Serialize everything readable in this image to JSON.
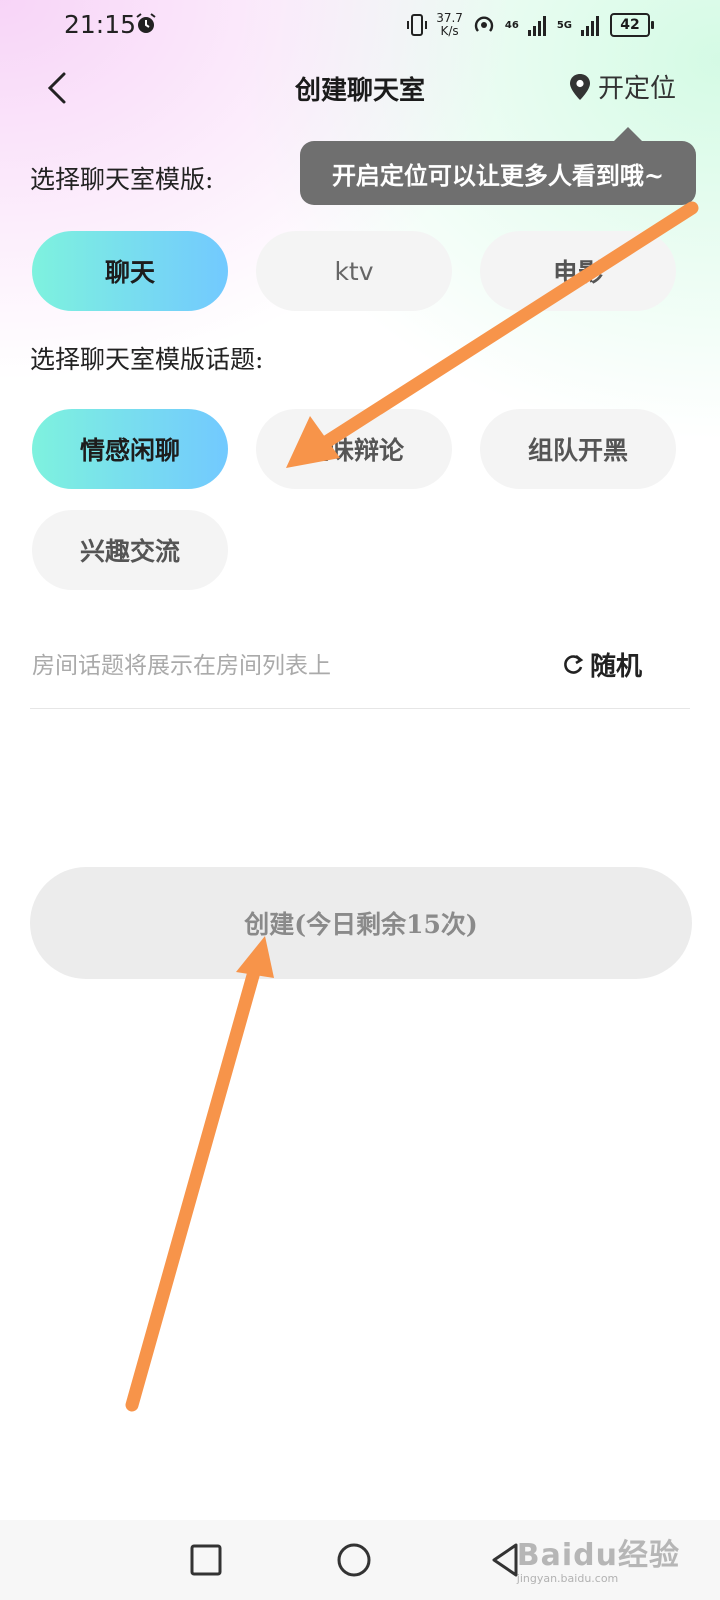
{
  "status_bar": {
    "time": "21:15",
    "net_speed_value": "37.7",
    "net_speed_unit": "K/s",
    "signal1_label": "46",
    "signal2_label": "5G",
    "battery": "42"
  },
  "header": {
    "title": "创建聊天室",
    "location_label": "开定位"
  },
  "tooltip": {
    "text": "开启定位可以让更多人看到哦~"
  },
  "templates": {
    "label": "选择聊天室模版:",
    "items": [
      {
        "label": "聊天",
        "selected": true
      },
      {
        "label": "ktv",
        "selected": false
      },
      {
        "label": "电影",
        "selected": false
      }
    ]
  },
  "topics": {
    "label": "选择聊天室模版话题:",
    "items": [
      {
        "label": "情感闲聊",
        "selected": true
      },
      {
        "label": "趣味辩论",
        "selected": false
      },
      {
        "label": "组队开黑",
        "selected": false
      },
      {
        "label": "兴趣交流",
        "selected": false
      }
    ]
  },
  "topic_input": {
    "placeholder": "房间话题将展示在房间列表上",
    "value": "",
    "random_label": "随机"
  },
  "create_button": {
    "label": "创建(今日剩余15次)"
  },
  "watermark": {
    "main": "Baidu经验",
    "sub": "jingyan.baidu.com"
  },
  "colors": {
    "chip_active_start": "#7ef2de",
    "chip_active_end": "#72c9ff",
    "annotation_arrow": "#f7944a",
    "tooltip_bg": "#6f6f6f"
  }
}
